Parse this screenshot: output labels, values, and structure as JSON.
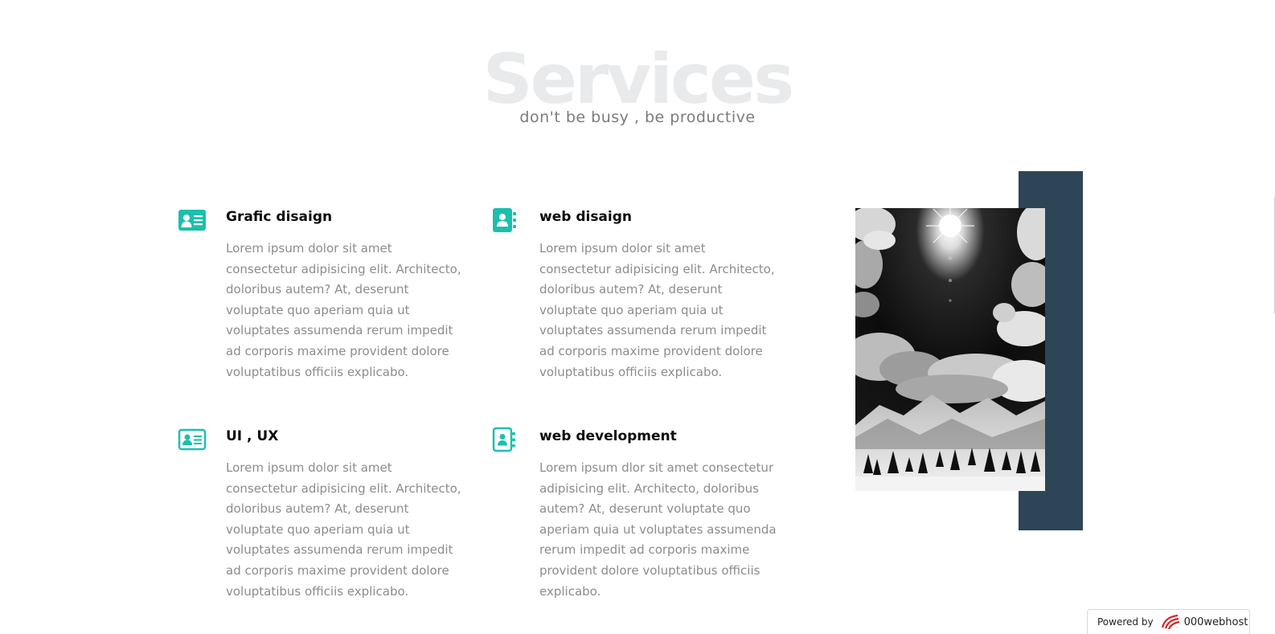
{
  "header": {
    "background_title": "Services",
    "subtitle": "don't be busy , be productive"
  },
  "services": [
    {
      "title": "Grafic disaign",
      "icon": "id-card-icon",
      "description": "Lorem ipsum dolor sit amet consectetur adipisicing elit. Architecto, doloribus autem? At, deserunt voluptate quo aperiam quia ut voluptates assumenda rerum impedit ad corporis maxime provident dolore voluptatibus officiis explicabo."
    },
    {
      "title": "web disaign",
      "icon": "address-book-icon",
      "description": "Lorem ipsum dolor sit amet consectetur adipisicing elit. Architecto, doloribus autem? At, deserunt voluptate quo aperiam quia ut voluptates assumenda rerum impedit ad corporis maxime provident dolore voluptatibus officiis explicabo."
    },
    {
      "title": "UI , UX",
      "icon": "id-card-outline-icon",
      "description": "Lorem ipsum dolor sit amet consectetur adipisicing elit. Architecto, doloribus autem? At, deserunt voluptate quo aperiam quia ut voluptates assumenda rerum impedit ad corporis maxime provident dolore voluptatibus officiis explicabo."
    },
    {
      "title": "web development",
      "icon": "address-book-outline-icon",
      "description": "Lorem ipsum dlor sit amet consectetur adipisicing elit. Architecto, doloribus autem? At, deserunt voluptate quo aperiam quia ut voluptates assumenda rerum impedit ad corporis maxime provident dolore voluptatibus officiis explicabo."
    }
  ],
  "image": {
    "subject": "black-and-white photo of sun over clouds and snowy mountains"
  },
  "footer": {
    "powered_by": "Powered by",
    "brand": "000webhost"
  },
  "colors": {
    "accent": "#1cbfae",
    "block": "#2c4557",
    "watermark": "#e9eaeb",
    "body_text": "#8c8c8c"
  }
}
